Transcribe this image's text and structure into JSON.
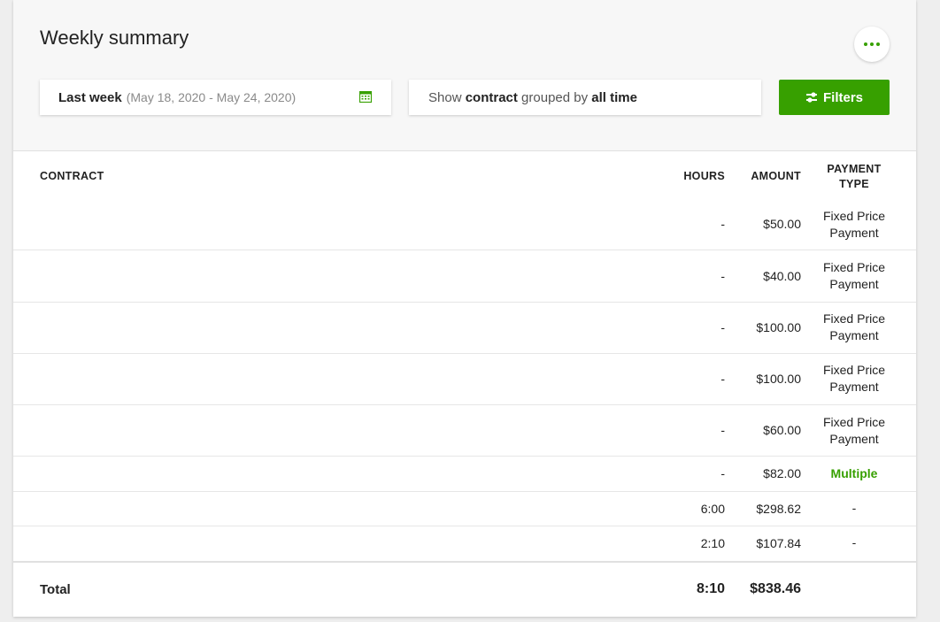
{
  "page": {
    "title": "Weekly summary"
  },
  "filters": {
    "date_label": "Last week",
    "date_range": "(May 18, 2020 - May 24, 2020)",
    "show_prefix": "Show ",
    "show_entity": "contract",
    "show_mid": " grouped by ",
    "show_group": "all time",
    "filters_button": "Filters"
  },
  "table": {
    "headers": {
      "contract": "CONTRACT",
      "hours": "HOURS",
      "amount": "AMOUNT",
      "payment_line1": "PAYMENT",
      "payment_line2": "TYPE"
    },
    "rows": [
      {
        "hours": "-",
        "amount": "$50.00",
        "ptype1": "Fixed Price",
        "ptype2": "Payment"
      },
      {
        "hours": "-",
        "amount": "$40.00",
        "ptype1": "Fixed Price",
        "ptype2": "Payment"
      },
      {
        "hours": "-",
        "amount": "$100.00",
        "ptype1": "Fixed Price",
        "ptype2": "Payment"
      },
      {
        "hours": "-",
        "amount": "$100.00",
        "ptype1": "Fixed Price",
        "ptype2": "Payment"
      },
      {
        "hours": "-",
        "amount": "$60.00",
        "ptype1": "Fixed Price",
        "ptype2": "Payment"
      },
      {
        "hours": "-",
        "amount": "$82.00",
        "ptype1": "Multiple",
        "ptype2": ""
      },
      {
        "hours": "6:00",
        "amount": "$298.62",
        "ptype1": "-",
        "ptype2": ""
      },
      {
        "hours": "2:10",
        "amount": "$107.84",
        "ptype1": "-",
        "ptype2": ""
      }
    ],
    "total": {
      "label": "Total",
      "hours": "8:10",
      "amount": "$838.46"
    }
  },
  "icons": {
    "more": "more-dots-icon",
    "calendar": "calendar-icon",
    "filters": "sliders-icon"
  },
  "colors": {
    "accent": "#37a000",
    "header_bg": "#f7f7f7"
  }
}
